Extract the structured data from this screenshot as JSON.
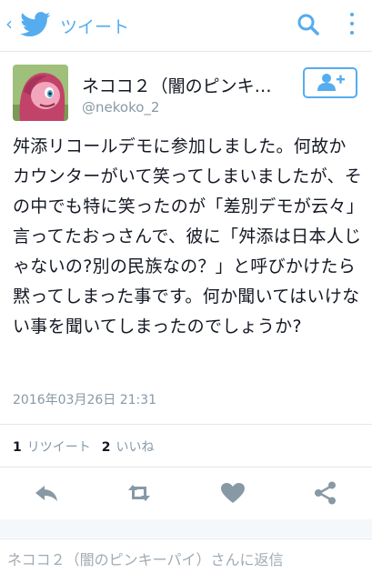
{
  "header": {
    "back_glyph": "‹",
    "title": "ツイート",
    "brand_color": "#55acee",
    "icons": [
      "twitter-bird-icon",
      "search-icon",
      "more-vertical-icon"
    ]
  },
  "user": {
    "display_name": "ネココ２（闇のピンキ…",
    "handle": "@nekoko_2",
    "follow_icon": "add-user-icon"
  },
  "tweet": {
    "text": "舛添リコールデモに参加しました。何故かカウンターがいて笑ってしまいましたが、その中でも特に笑ったのが「差別デモが云々」言ってたおっさんで、彼に「舛添は日本人じゃないの?別の民族なの？」と呼びかけたら黙ってしまった事です。何か聞いてはいけない事を聞いてしまったのでしょうか?",
    "timestamp": "2016年03月26日 21:31"
  },
  "stats": {
    "retweet_count": "1",
    "retweet_label": "リツイート",
    "like_count": "2",
    "like_label": "いいね"
  },
  "actions": [
    "reply-icon",
    "retweet-icon",
    "like-heart-icon",
    "share-icon"
  ],
  "reply": {
    "placeholder": "ネココ２（闇のピンキーパイ）さんに返信"
  }
}
